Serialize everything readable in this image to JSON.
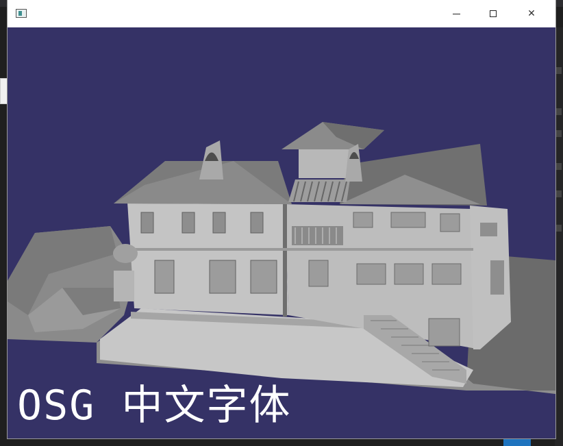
{
  "window": {
    "title": "",
    "icon": "app-window-icon",
    "controls": {
      "minimize_icon": "minimize-icon",
      "maximize_icon": "maximize-icon",
      "close_icon": "close-icon",
      "close_glyph": "✕"
    }
  },
  "viewport": {
    "background_color": "#353266",
    "scene": "3d-house-model",
    "overlay_text": "OSG 中文字体"
  },
  "colors": {
    "model_light": "#c7c7c7",
    "model_mid": "#a9a9a9",
    "model_dark": "#7a7a7a",
    "model_shadow": "#5a5a5a"
  }
}
